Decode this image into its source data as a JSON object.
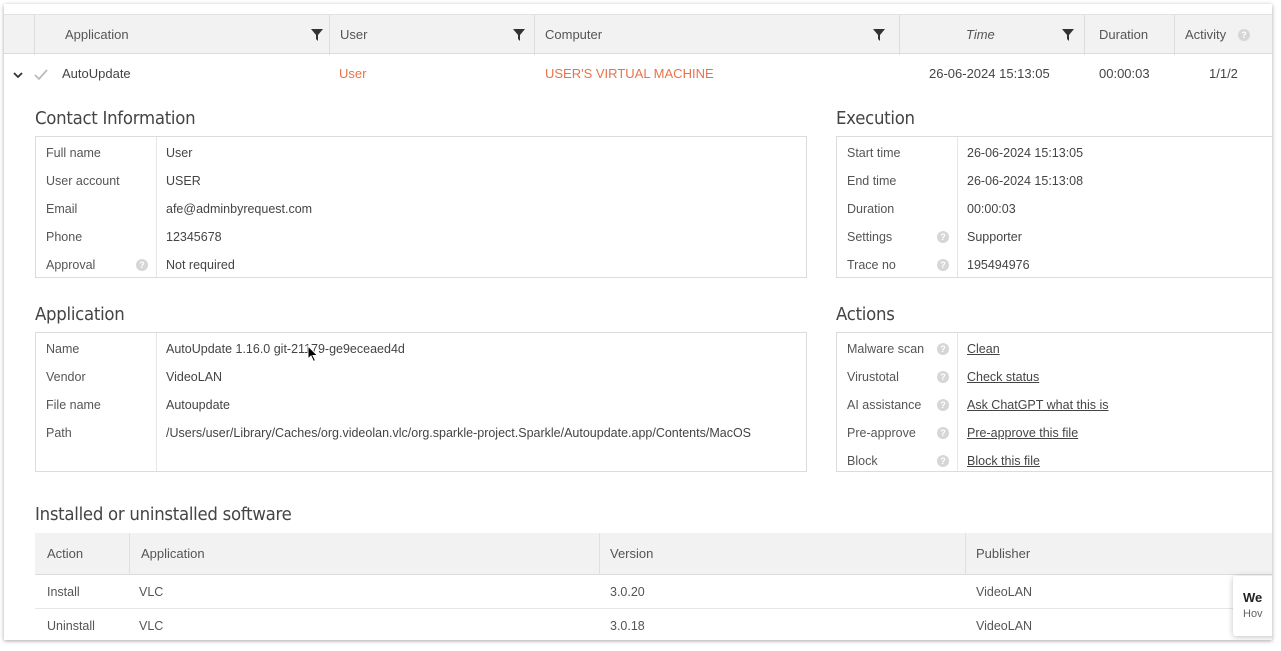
{
  "header": {
    "columns": [
      {
        "label": "Application"
      },
      {
        "label": "User"
      },
      {
        "label": "Computer"
      },
      {
        "label": "Time"
      },
      {
        "label": "Duration"
      },
      {
        "label": "Activity"
      }
    ]
  },
  "row": {
    "application": "AutoUpdate",
    "user": "User",
    "computer": "USER'S VIRTUAL MACHINE",
    "time": "26-06-2024 15:13:05",
    "duration": "00:00:03",
    "activity": "1/1/2"
  },
  "contact": {
    "title": "Contact Information",
    "fields": [
      {
        "key": "Full name",
        "value": "User"
      },
      {
        "key": "User account",
        "value": "USER"
      },
      {
        "key": "Email",
        "value": "afe@adminbyrequest.com"
      },
      {
        "key": "Phone",
        "value": "12345678"
      },
      {
        "key": "Approval",
        "value": "Not required"
      }
    ]
  },
  "execution": {
    "title": "Execution",
    "fields": [
      {
        "key": "Start time",
        "value": "26-06-2024 15:13:05"
      },
      {
        "key": "End time",
        "value": "26-06-2024 15:13:08"
      },
      {
        "key": "Duration",
        "value": "00:00:03"
      },
      {
        "key": "Settings",
        "value": "Supporter"
      },
      {
        "key": "Trace no",
        "value": "195494976"
      }
    ]
  },
  "application": {
    "title": "Application",
    "fields": [
      {
        "key": "Name",
        "value": "AutoUpdate 1.16.0 git-21179-ge9eceaed4d"
      },
      {
        "key": "Vendor",
        "value": "VideoLAN"
      },
      {
        "key": "File name",
        "value": "Autoupdate"
      },
      {
        "key": "Path",
        "value": "/Users/user/Library/Caches/org.videolan.vlc/org.sparkle-project.Sparkle/Autoupdate.app/Contents/MacOS"
      }
    ]
  },
  "actions": {
    "title": "Actions",
    "fields": [
      {
        "key": "Malware scan",
        "value": "Clean"
      },
      {
        "key": "Virustotal",
        "value": "Check status"
      },
      {
        "key": "AI assistance",
        "value": "Ask ChatGPT what this is"
      },
      {
        "key": "Pre-approve",
        "value": "Pre-approve this file"
      },
      {
        "key": "Block",
        "value": "Block this file"
      }
    ]
  },
  "software": {
    "title": "Installed or uninstalled software",
    "headers": {
      "action": "Action",
      "application": "Application",
      "version": "Version",
      "publisher": "Publisher"
    },
    "rows": [
      {
        "action": "Install",
        "application": "VLC",
        "version": "3.0.20",
        "publisher": "VideoLAN"
      },
      {
        "action": "Uninstall",
        "application": "VLC",
        "version": "3.0.18",
        "publisher": "VideoLAN"
      }
    ]
  },
  "toast": {
    "line1": "We",
    "line2": "Hov"
  },
  "colors": {
    "accent_orange": "#e8734a",
    "link_orange": "#e8832a",
    "header_bg": "#f2f2f2"
  },
  "icons": [
    "filter-icon",
    "help-icon",
    "chevron-down-icon",
    "check-icon"
  ]
}
